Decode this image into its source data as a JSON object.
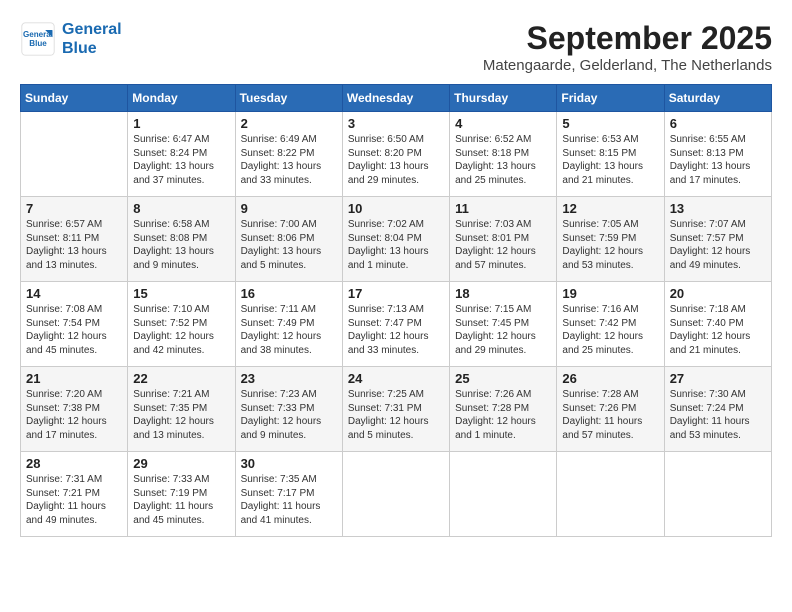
{
  "header": {
    "logo_line1": "General",
    "logo_line2": "Blue",
    "month": "September 2025",
    "location": "Matengaarde, Gelderland, The Netherlands"
  },
  "weekdays": [
    "Sunday",
    "Monday",
    "Tuesday",
    "Wednesday",
    "Thursday",
    "Friday",
    "Saturday"
  ],
  "weeks": [
    [
      {
        "day": "",
        "info": ""
      },
      {
        "day": "1",
        "info": "Sunrise: 6:47 AM\nSunset: 8:24 PM\nDaylight: 13 hours\nand 37 minutes."
      },
      {
        "day": "2",
        "info": "Sunrise: 6:49 AM\nSunset: 8:22 PM\nDaylight: 13 hours\nand 33 minutes."
      },
      {
        "day": "3",
        "info": "Sunrise: 6:50 AM\nSunset: 8:20 PM\nDaylight: 13 hours\nand 29 minutes."
      },
      {
        "day": "4",
        "info": "Sunrise: 6:52 AM\nSunset: 8:18 PM\nDaylight: 13 hours\nand 25 minutes."
      },
      {
        "day": "5",
        "info": "Sunrise: 6:53 AM\nSunset: 8:15 PM\nDaylight: 13 hours\nand 21 minutes."
      },
      {
        "day": "6",
        "info": "Sunrise: 6:55 AM\nSunset: 8:13 PM\nDaylight: 13 hours\nand 17 minutes."
      }
    ],
    [
      {
        "day": "7",
        "info": "Sunrise: 6:57 AM\nSunset: 8:11 PM\nDaylight: 13 hours\nand 13 minutes."
      },
      {
        "day": "8",
        "info": "Sunrise: 6:58 AM\nSunset: 8:08 PM\nDaylight: 13 hours\nand 9 minutes."
      },
      {
        "day": "9",
        "info": "Sunrise: 7:00 AM\nSunset: 8:06 PM\nDaylight: 13 hours\nand 5 minutes."
      },
      {
        "day": "10",
        "info": "Sunrise: 7:02 AM\nSunset: 8:04 PM\nDaylight: 13 hours\nand 1 minute."
      },
      {
        "day": "11",
        "info": "Sunrise: 7:03 AM\nSunset: 8:01 PM\nDaylight: 12 hours\nand 57 minutes."
      },
      {
        "day": "12",
        "info": "Sunrise: 7:05 AM\nSunset: 7:59 PM\nDaylight: 12 hours\nand 53 minutes."
      },
      {
        "day": "13",
        "info": "Sunrise: 7:07 AM\nSunset: 7:57 PM\nDaylight: 12 hours\nand 49 minutes."
      }
    ],
    [
      {
        "day": "14",
        "info": "Sunrise: 7:08 AM\nSunset: 7:54 PM\nDaylight: 12 hours\nand 45 minutes."
      },
      {
        "day": "15",
        "info": "Sunrise: 7:10 AM\nSunset: 7:52 PM\nDaylight: 12 hours\nand 42 minutes."
      },
      {
        "day": "16",
        "info": "Sunrise: 7:11 AM\nSunset: 7:49 PM\nDaylight: 12 hours\nand 38 minutes."
      },
      {
        "day": "17",
        "info": "Sunrise: 7:13 AM\nSunset: 7:47 PM\nDaylight: 12 hours\nand 33 minutes."
      },
      {
        "day": "18",
        "info": "Sunrise: 7:15 AM\nSunset: 7:45 PM\nDaylight: 12 hours\nand 29 minutes."
      },
      {
        "day": "19",
        "info": "Sunrise: 7:16 AM\nSunset: 7:42 PM\nDaylight: 12 hours\nand 25 minutes."
      },
      {
        "day": "20",
        "info": "Sunrise: 7:18 AM\nSunset: 7:40 PM\nDaylight: 12 hours\nand 21 minutes."
      }
    ],
    [
      {
        "day": "21",
        "info": "Sunrise: 7:20 AM\nSunset: 7:38 PM\nDaylight: 12 hours\nand 17 minutes."
      },
      {
        "day": "22",
        "info": "Sunrise: 7:21 AM\nSunset: 7:35 PM\nDaylight: 12 hours\nand 13 minutes."
      },
      {
        "day": "23",
        "info": "Sunrise: 7:23 AM\nSunset: 7:33 PM\nDaylight: 12 hours\nand 9 minutes."
      },
      {
        "day": "24",
        "info": "Sunrise: 7:25 AM\nSunset: 7:31 PM\nDaylight: 12 hours\nand 5 minutes."
      },
      {
        "day": "25",
        "info": "Sunrise: 7:26 AM\nSunset: 7:28 PM\nDaylight: 12 hours\nand 1 minute."
      },
      {
        "day": "26",
        "info": "Sunrise: 7:28 AM\nSunset: 7:26 PM\nDaylight: 11 hours\nand 57 minutes."
      },
      {
        "day": "27",
        "info": "Sunrise: 7:30 AM\nSunset: 7:24 PM\nDaylight: 11 hours\nand 53 minutes."
      }
    ],
    [
      {
        "day": "28",
        "info": "Sunrise: 7:31 AM\nSunset: 7:21 PM\nDaylight: 11 hours\nand 49 minutes."
      },
      {
        "day": "29",
        "info": "Sunrise: 7:33 AM\nSunset: 7:19 PM\nDaylight: 11 hours\nand 45 minutes."
      },
      {
        "day": "30",
        "info": "Sunrise: 7:35 AM\nSunset: 7:17 PM\nDaylight: 11 hours\nand 41 minutes."
      },
      {
        "day": "",
        "info": ""
      },
      {
        "day": "",
        "info": ""
      },
      {
        "day": "",
        "info": ""
      },
      {
        "day": "",
        "info": ""
      }
    ]
  ]
}
